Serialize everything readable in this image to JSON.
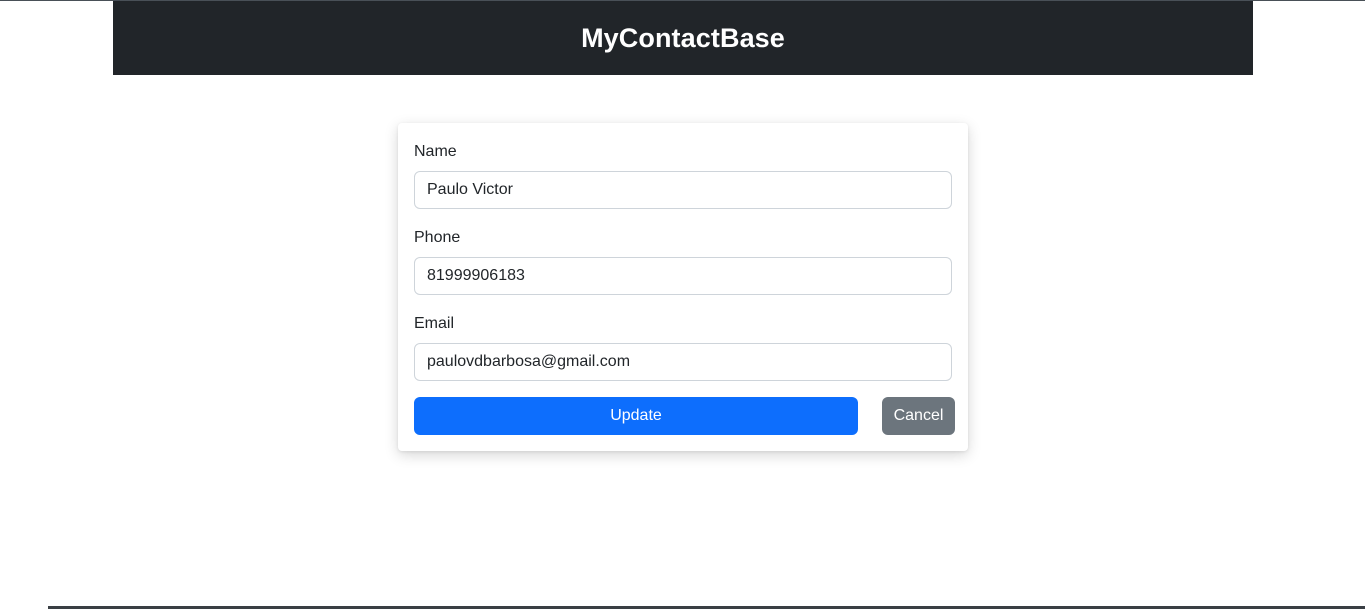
{
  "header": {
    "title": "MyContactBase"
  },
  "form": {
    "name": {
      "label": "Name",
      "value": "Paulo Victor"
    },
    "phone": {
      "label": "Phone",
      "value": "81999906183"
    },
    "email": {
      "label": "Email",
      "value": "paulovdbarbosa@gmail.com"
    },
    "update_label": "Update",
    "cancel_label": "Cancel"
  },
  "colors": {
    "header_bg": "#212529",
    "primary": "#0d6efd",
    "secondary": "#6c757d"
  }
}
